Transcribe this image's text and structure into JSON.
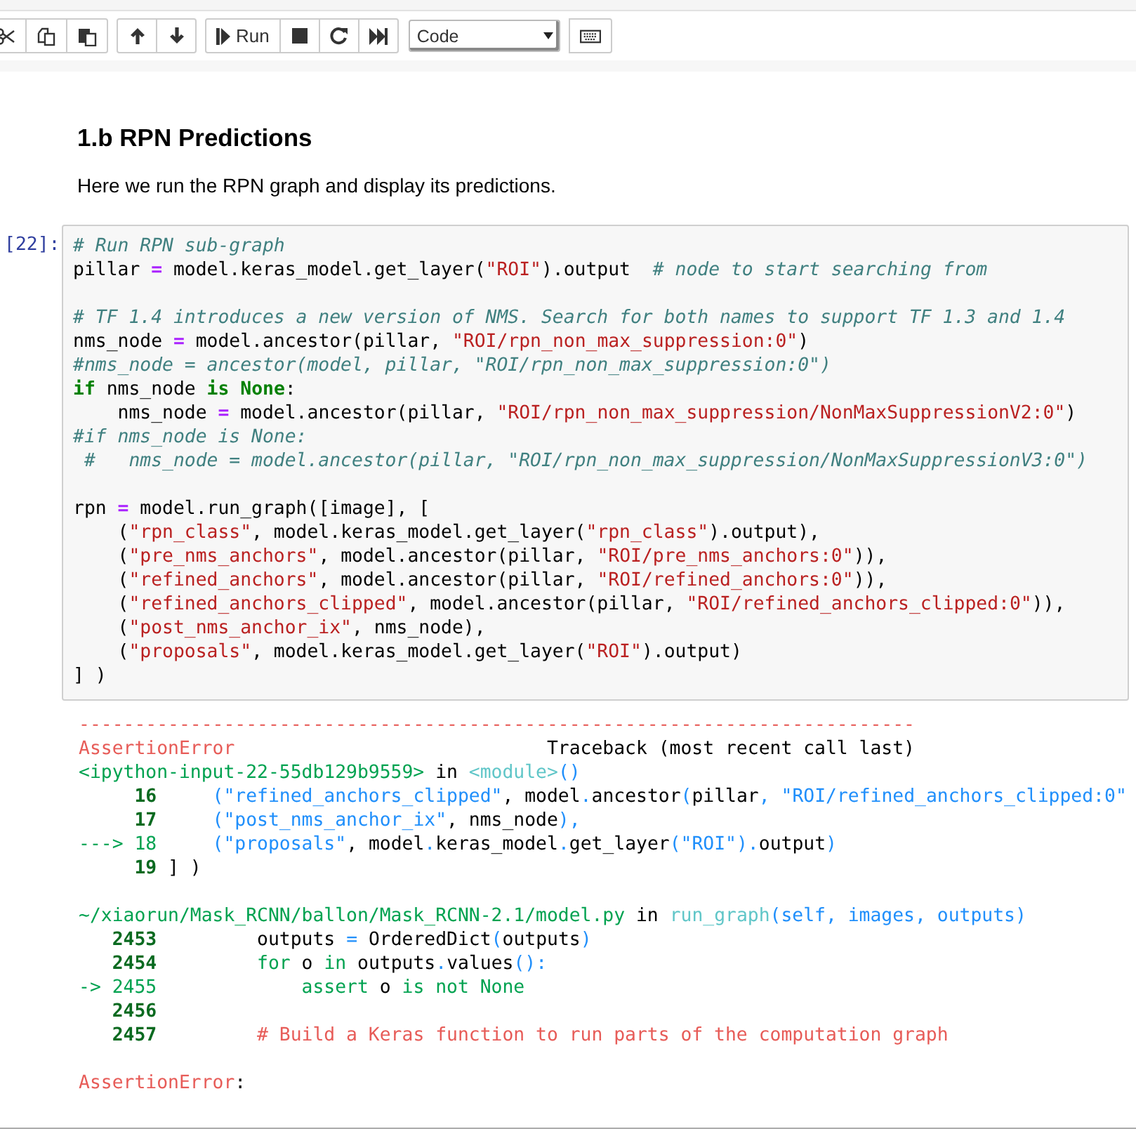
{
  "toolbar": {
    "run_label": "Run",
    "cell_type": "Code"
  },
  "markdown": {
    "heading": "1.b RPN Predictions",
    "paragraph": "Here we run the RPN graph and display its predictions."
  },
  "cell": {
    "prompt": "[22]:",
    "lines": [
      {
        "kind": "code",
        "segments": [
          {
            "kind": "comment",
            "text": "# Run RPN sub-graph"
          }
        ]
      },
      {
        "kind": "code",
        "segments": [
          {
            "kind": "plain",
            "text": "pillar "
          },
          {
            "kind": "op",
            "text": "="
          },
          {
            "kind": "plain",
            "text": " model.keras_model.get_layer("
          },
          {
            "kind": "string",
            "text": "\"ROI\""
          },
          {
            "kind": "plain",
            "text": ").output  "
          },
          {
            "kind": "comment",
            "text": "# node to start searching from"
          }
        ]
      },
      {
        "kind": "blank"
      },
      {
        "kind": "code",
        "segments": [
          {
            "kind": "comment",
            "text": "# TF 1.4 introduces a new version of NMS. Search for both names to support TF 1.3 and 1.4"
          }
        ]
      },
      {
        "kind": "code",
        "segments": [
          {
            "kind": "plain",
            "text": "nms_node "
          },
          {
            "kind": "op",
            "text": "="
          },
          {
            "kind": "plain",
            "text": " model.ancestor(pillar, "
          },
          {
            "kind": "string",
            "text": "\"ROI/rpn_non_max_suppression:0\""
          },
          {
            "kind": "plain",
            "text": ")"
          }
        ]
      },
      {
        "kind": "code",
        "segments": [
          {
            "kind": "comment",
            "text": "#nms_node = ancestor(model, pillar, \"ROI/rpn_non_max_suppression:0\")"
          }
        ]
      },
      {
        "kind": "code",
        "segments": [
          {
            "kind": "keyword",
            "text": "if"
          },
          {
            "kind": "plain",
            "text": " nms_node "
          },
          {
            "kind": "keyword",
            "text": "is"
          },
          {
            "kind": "keyword",
            "text": " None"
          },
          {
            "kind": "plain",
            "text": ":"
          }
        ]
      },
      {
        "kind": "code",
        "segments": [
          {
            "kind": "plain",
            "text": "    nms_node "
          },
          {
            "kind": "op",
            "text": "="
          },
          {
            "kind": "plain",
            "text": " model.ancestor(pillar, "
          },
          {
            "kind": "string",
            "text": "\"ROI/rpn_non_max_suppression/NonMaxSuppressionV2:0\""
          },
          {
            "kind": "plain",
            "text": ")"
          }
        ]
      },
      {
        "kind": "code",
        "segments": [
          {
            "kind": "comment",
            "text": "#if nms_node is None:"
          }
        ]
      },
      {
        "kind": "code",
        "segments": [
          {
            "kind": "comment",
            "text": " #   nms_node = model.ancestor(pillar, \"ROI/rpn_non_max_suppression/NonMaxSuppressionV3:0\")"
          }
        ]
      },
      {
        "kind": "blank"
      },
      {
        "kind": "code",
        "segments": [
          {
            "kind": "plain",
            "text": "rpn "
          },
          {
            "kind": "op",
            "text": "="
          },
          {
            "kind": "plain",
            "text": " model.run_graph([image], ["
          }
        ]
      },
      {
        "kind": "code",
        "segments": [
          {
            "kind": "plain",
            "text": "    ("
          },
          {
            "kind": "string",
            "text": "\"rpn_class\""
          },
          {
            "kind": "plain",
            "text": ", model.keras_model.get_layer("
          },
          {
            "kind": "string",
            "text": "\"rpn_class\""
          },
          {
            "kind": "plain",
            "text": ").output),"
          }
        ]
      },
      {
        "kind": "code",
        "segments": [
          {
            "kind": "plain",
            "text": "    ("
          },
          {
            "kind": "string",
            "text": "\"pre_nms_anchors\""
          },
          {
            "kind": "plain",
            "text": ", model.ancestor(pillar, "
          },
          {
            "kind": "string",
            "text": "\"ROI/pre_nms_anchors:0\""
          },
          {
            "kind": "plain",
            "text": ")),"
          }
        ]
      },
      {
        "kind": "code",
        "segments": [
          {
            "kind": "plain",
            "text": "    ("
          },
          {
            "kind": "string",
            "text": "\"refined_anchors\""
          },
          {
            "kind": "plain",
            "text": ", model.ancestor(pillar, "
          },
          {
            "kind": "string",
            "text": "\"ROI/refined_anchors:0\""
          },
          {
            "kind": "plain",
            "text": ")),"
          }
        ]
      },
      {
        "kind": "code",
        "segments": [
          {
            "kind": "plain",
            "text": "    ("
          },
          {
            "kind": "string",
            "text": "\"refined_anchors_clipped\""
          },
          {
            "kind": "plain",
            "text": ", model.ancestor(pillar, "
          },
          {
            "kind": "string",
            "text": "\"ROI/refined_anchors_clipped:0\""
          },
          {
            "kind": "plain",
            "text": ")),"
          }
        ]
      },
      {
        "kind": "code",
        "segments": [
          {
            "kind": "plain",
            "text": "    ("
          },
          {
            "kind": "string",
            "text": "\"post_nms_anchor_ix\""
          },
          {
            "kind": "plain",
            "text": ", nms_node),"
          }
        ]
      },
      {
        "kind": "code",
        "segments": [
          {
            "kind": "plain",
            "text": "    ("
          },
          {
            "kind": "string",
            "text": "\"proposals\""
          },
          {
            "kind": "plain",
            "text": ", model.keras_model.get_layer("
          },
          {
            "kind": "string",
            "text": "\"ROI\""
          },
          {
            "kind": "plain",
            "text": ").output)"
          }
        ]
      },
      {
        "kind": "code",
        "segments": [
          {
            "kind": "plain",
            "text": "] )"
          }
        ]
      }
    ]
  },
  "output": {
    "lines": [
      {
        "kind": "code",
        "segments": [
          {
            "kind": "red",
            "text": "---------------------------------------------------------------------------"
          }
        ]
      },
      {
        "kind": "code",
        "segments": [
          {
            "kind": "red",
            "text": "AssertionError"
          },
          {
            "kind": "plain",
            "text": "                            Traceback (most recent call last)"
          }
        ]
      },
      {
        "kind": "code",
        "segments": [
          {
            "kind": "green",
            "text": "<ipython-input-22-55db129b9559>"
          },
          {
            "kind": "plain",
            "text": " in "
          },
          {
            "kind": "cyan",
            "text": "<module>"
          },
          {
            "kind": "blue",
            "text": "()"
          }
        ]
      },
      {
        "kind": "code",
        "segments": [
          {
            "kind": "num",
            "text": "     16"
          },
          {
            "kind": "blue",
            "text": "     (\"refined_anchors_clipped\""
          },
          {
            "kind": "plain",
            "text": ", model"
          },
          {
            "kind": "blue",
            "text": "."
          },
          {
            "kind": "plain",
            "text": "ancestor"
          },
          {
            "kind": "blue",
            "text": "("
          },
          {
            "kind": "plain",
            "text": "pillar"
          },
          {
            "kind": "blue",
            "text": ", \"ROI/refined_anchors_clipped:0\""
          }
        ]
      },
      {
        "kind": "code",
        "segments": [
          {
            "kind": "num",
            "text": "     17"
          },
          {
            "kind": "blue",
            "text": "     (\"post_nms_anchor_ix\""
          },
          {
            "kind": "plain",
            "text": ", nms_node"
          },
          {
            "kind": "blue",
            "text": "),"
          }
        ]
      },
      {
        "kind": "code",
        "segments": [
          {
            "kind": "green",
            "text": "---> 18"
          },
          {
            "kind": "blue",
            "text": "     (\"proposals\""
          },
          {
            "kind": "plain",
            "text": ", model"
          },
          {
            "kind": "blue",
            "text": "."
          },
          {
            "kind": "plain",
            "text": "keras_model"
          },
          {
            "kind": "blue",
            "text": "."
          },
          {
            "kind": "plain",
            "text": "get_layer"
          },
          {
            "kind": "blue",
            "text": "(\"ROI\")."
          },
          {
            "kind": "plain",
            "text": "output"
          },
          {
            "kind": "blue",
            "text": ")"
          }
        ]
      },
      {
        "kind": "code",
        "segments": [
          {
            "kind": "num",
            "text": "     19"
          },
          {
            "kind": "plain",
            "text": " ] )"
          }
        ]
      },
      {
        "kind": "blank"
      },
      {
        "kind": "code",
        "segments": [
          {
            "kind": "green",
            "text": "~/xiaorun/Mask_RCNN/ballon/Mask_RCNN-2.1/model.py"
          },
          {
            "kind": "plain",
            "text": " in "
          },
          {
            "kind": "cyan",
            "text": "run_graph"
          },
          {
            "kind": "blue",
            "text": "(self, images, outputs)"
          }
        ]
      },
      {
        "kind": "code",
        "segments": [
          {
            "kind": "num",
            "text": "   2453"
          },
          {
            "kind": "plain",
            "text": "         outputs "
          },
          {
            "kind": "blue",
            "text": "="
          },
          {
            "kind": "plain",
            "text": " OrderedDict"
          },
          {
            "kind": "blue",
            "text": "("
          },
          {
            "kind": "plain",
            "text": "outputs"
          },
          {
            "kind": "blue",
            "text": ")"
          }
        ]
      },
      {
        "kind": "code",
        "segments": [
          {
            "kind": "num",
            "text": "   2454"
          },
          {
            "kind": "green",
            "text": "         for"
          },
          {
            "kind": "plain",
            "text": " o "
          },
          {
            "kind": "green",
            "text": "in"
          },
          {
            "kind": "plain",
            "text": " outputs"
          },
          {
            "kind": "blue",
            "text": "."
          },
          {
            "kind": "plain",
            "text": "values"
          },
          {
            "kind": "blue",
            "text": "():"
          }
        ]
      },
      {
        "kind": "code",
        "segments": [
          {
            "kind": "green",
            "text": "-> 2455             assert"
          },
          {
            "kind": "plain",
            "text": " o "
          },
          {
            "kind": "green",
            "text": "is not None"
          }
        ]
      },
      {
        "kind": "code",
        "segments": [
          {
            "kind": "num",
            "text": "   2456"
          }
        ]
      },
      {
        "kind": "code",
        "segments": [
          {
            "kind": "num",
            "text": "   2457"
          },
          {
            "kind": "red",
            "text": "         # Build a Keras function to run parts of the computation graph"
          }
        ]
      },
      {
        "kind": "blank"
      },
      {
        "kind": "code",
        "segments": [
          {
            "kind": "red",
            "text": "AssertionError"
          },
          {
            "kind": "plain",
            "text": ":"
          }
        ]
      }
    ]
  }
}
